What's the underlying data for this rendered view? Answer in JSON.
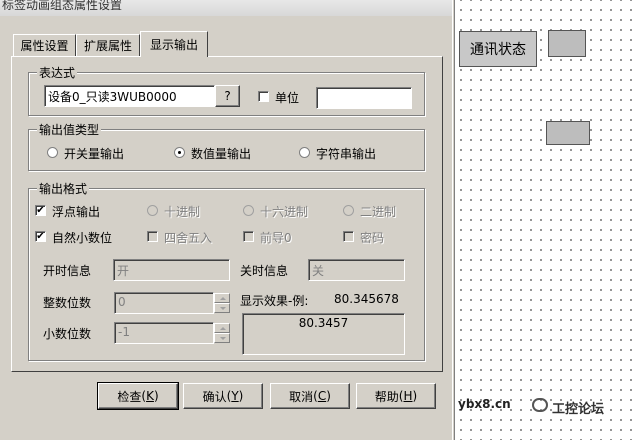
{
  "window": {
    "title": "标签动画组态属性设置"
  },
  "tabs": [
    {
      "label": "属性设置"
    },
    {
      "label": "扩展属性"
    },
    {
      "label": "显示输出"
    }
  ],
  "expression": {
    "group_title": "表达式",
    "value": "设备0_只读3WUB0000",
    "help_button": "?",
    "unit_label": "单位",
    "unit_checked": false,
    "unit_value": ""
  },
  "output_type": {
    "group_title": "输出值类型",
    "options": [
      {
        "label": "开关量输出",
        "selected": false
      },
      {
        "label": "数值量输出",
        "selected": true
      },
      {
        "label": "字符串输出",
        "selected": false
      }
    ]
  },
  "output_format": {
    "group_title": "输出格式",
    "float_output": {
      "label": "浮点输出",
      "checked": true
    },
    "radix": [
      {
        "label": "十进制"
      },
      {
        "label": "十六进制"
      },
      {
        "label": "二进制"
      }
    ],
    "natural_decimal": {
      "label": "自然小数位",
      "checked": true
    },
    "round": {
      "label": "四舍五入"
    },
    "leading_zero": {
      "label": "前导0"
    },
    "password": {
      "label": "密码"
    },
    "on_info_label": "开时信息",
    "on_info_value": "开",
    "off_info_label": "关时信息",
    "off_info_value": "关",
    "integer_digits_label": "整数位数",
    "integer_digits_value": "0",
    "decimal_digits_label": "小数位数",
    "decimal_digits_value": "-1",
    "preview_label": "显示效果-例:",
    "preview_example": "80.345678",
    "preview_result": "80.3457"
  },
  "buttons": {
    "check": "检查",
    "check_key": "K",
    "confirm": "确认",
    "confirm_key": "Y",
    "cancel": "取消",
    "cancel_key": "C",
    "help": "帮助",
    "help_key": "H"
  },
  "canvas": {
    "comm_status": "通讯状态",
    "watermark_url": "ybx8.cn",
    "watermark_text": "工控论坛"
  }
}
